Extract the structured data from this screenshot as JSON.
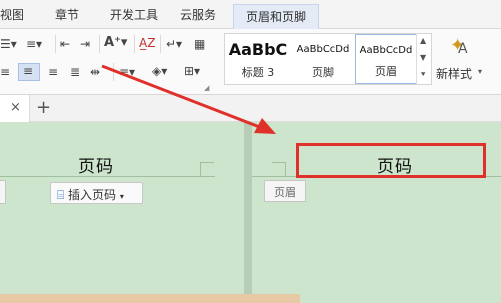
{
  "menu": {
    "tabs": [
      {
        "label": "视图"
      },
      {
        "label": "章节"
      },
      {
        "label": "开发工具"
      },
      {
        "label": "云服务"
      },
      {
        "label": "页眉和页脚"
      }
    ]
  },
  "ribbon": {
    "styles": [
      {
        "preview": "AaBbC",
        "label": "标题 3"
      },
      {
        "preview": "AaBbCcDd",
        "label": "页脚"
      },
      {
        "preview": "AaBbCcDd",
        "label": "页眉"
      }
    ],
    "new_style_label": "新样式"
  },
  "doc_tabs": {
    "close_glyph": "×",
    "add_glyph": "+"
  },
  "document": {
    "left_header_text": "页码",
    "right_header_text": "页码",
    "insert_page_number_label": "插入页码",
    "header_tag_label": "页眉"
  },
  "colors": {
    "highlight": "#e0302a",
    "page_background": "#cde4cd",
    "arrow": "#e0302a"
  }
}
